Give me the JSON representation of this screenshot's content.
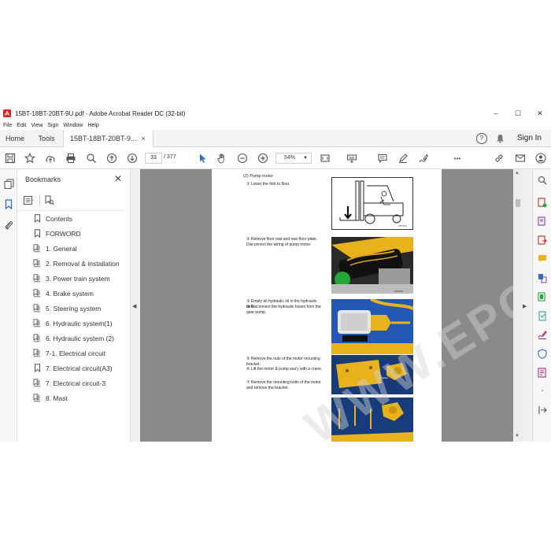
{
  "window": {
    "title": "15BT-18BT-20BT-9U.pdf - Adobe Acrobat Reader DC (32-bit)",
    "minimize": "–",
    "maximize": "☐",
    "close": "✕"
  },
  "menu": [
    "File",
    "Edit",
    "View",
    "Sign",
    "Window",
    "Help"
  ],
  "tabs": {
    "home": "Home",
    "tools": "Tools",
    "doc": "15BT-18BT-20BT-9...",
    "doc_close": "×",
    "help": "?",
    "sign_in": "Sign In"
  },
  "toolbar": {
    "page_current": "33",
    "page_total": "/ 377",
    "zoom": "54%",
    "more": "•••"
  },
  "bookmarks": {
    "title": "Bookmarks",
    "close": "✕",
    "items": [
      {
        "label": "Contents",
        "icon": "bookmark-icon"
      },
      {
        "label": "FORWORD",
        "icon": "bookmark-icon"
      },
      {
        "label": "1. General",
        "icon": "bookmark-page-icon"
      },
      {
        "label": "2. Removal & installation",
        "icon": "bookmark-page-icon"
      },
      {
        "label": "3. Power train system",
        "icon": "bookmark-page-icon"
      },
      {
        "label": "4. Brake system",
        "icon": "bookmark-page-icon"
      },
      {
        "label": "5. Steering system",
        "icon": "bookmark-page-icon"
      },
      {
        "label": "6. Hydraulic system(1)",
        "icon": "bookmark-page-icon"
      },
      {
        "label": "6. Hydraulic system (2)",
        "icon": "bookmark-page-icon"
      },
      {
        "label": "7-1. Electrical circuit",
        "icon": "bookmark-page-icon"
      },
      {
        "label": "7. Electrical circuit(A3)",
        "icon": "bookmark-icon"
      },
      {
        "label": "7. Electrical circuit-3",
        "icon": "bookmark-page-icon"
      },
      {
        "label": "8. Mast",
        "icon": "bookmark-page-icon"
      }
    ]
  },
  "page": {
    "heading": "(2) Pump motor",
    "step1": "① Lower the fork to floor.",
    "step2": "② Remove floor mat and rear floor plate. Disconnect the wiring of pump motor.",
    "step3": "③ Empty all hydraulic oil in the hydraulic tank.",
    "step4": "④ Disconnect the hydraulic hoses form the gear pump.",
    "step5": "⑤ Remove the nuts of the motor mounting bracket.",
    "step6": "⑥ Lift the motor & pump asa'y with a crane.",
    "step7": "⑦ Remove the mounting bolts of the motor and remove the bracket.",
    "watermark": "WWW.EPCDE.COM"
  },
  "colors": {
    "accent_blue": "#2c6fd1",
    "acrobat_red": "#d9281f",
    "machine_yellow": "#e8b21c"
  }
}
